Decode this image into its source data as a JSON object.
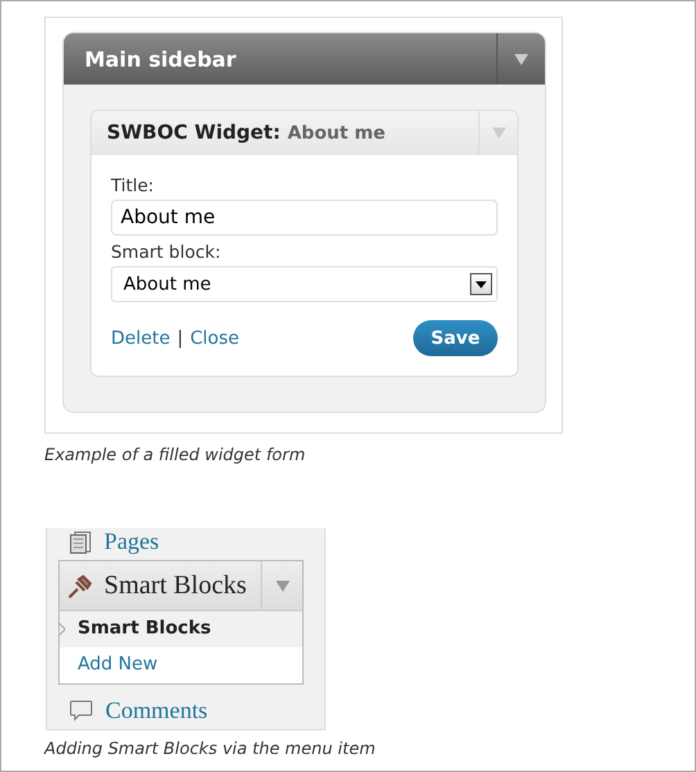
{
  "figures": [
    {
      "kind": "widget",
      "sidebar_title": "Main sidebar",
      "widget_name": "SWBOC Widget:",
      "widget_subtitle": "About me",
      "fields": [
        {
          "kind": "text",
          "label": "Title:",
          "value": "About me"
        },
        {
          "kind": "select",
          "label": "Smart block:",
          "value": "About me"
        }
      ],
      "links": [
        "Delete",
        "Close"
      ],
      "link_separator": "|",
      "save": "Save",
      "caption": "Example of a filled widget form"
    },
    {
      "kind": "menu",
      "items": [
        {
          "kind": "pages",
          "label": "Pages",
          "expanded": false
        },
        {
          "kind": "pin",
          "label": "Smart Blocks",
          "expanded": true,
          "children": [
            {
              "label": "Smart Blocks",
              "selected": true
            },
            {
              "label": "Add New",
              "selected": false
            }
          ]
        },
        {
          "kind": "comments",
          "label": "Comments",
          "expanded": false
        }
      ],
      "caption": "Adding Smart Blocks via the menu item"
    }
  ]
}
